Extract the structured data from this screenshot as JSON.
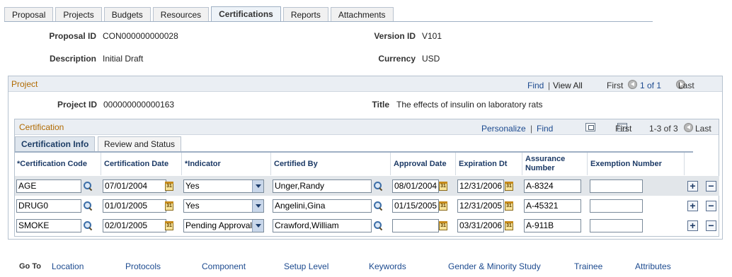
{
  "tabs": [
    {
      "label": "Proposal"
    },
    {
      "label": "Projects"
    },
    {
      "label": "Budgets"
    },
    {
      "label": "Resources"
    },
    {
      "label": "Certifications",
      "active": true
    },
    {
      "label": "Reports"
    },
    {
      "label": "Attachments"
    }
  ],
  "header": {
    "proposal_id_label": "Proposal ID",
    "proposal_id": "CON000000000028",
    "version_id_label": "Version ID",
    "version_id": "V101",
    "description_label": "Description",
    "description": "Initial Draft",
    "currency_label": "Currency",
    "currency": "USD"
  },
  "project": {
    "title": "Project",
    "find": "Find",
    "sep": "|",
    "view_all": "View All",
    "first": "First",
    "range": "1 of 1",
    "last": "Last",
    "project_id_label": "Project ID",
    "project_id": "000000000000163",
    "title_label": "Title",
    "title_value": "The effects of insulin on laboratory rats"
  },
  "certification": {
    "title": "Certification",
    "personalize": "Personalize",
    "sep": "|",
    "find": "Find",
    "first": "First",
    "range": "1-3 of 3",
    "last": "Last",
    "subtabs": [
      "Certification Info",
      "Review and Status"
    ],
    "columns": {
      "code": "*Certification Code",
      "date": "Certification Date",
      "indicator": "*Indicator",
      "certified_by": "Certified By",
      "approval_date": "Approval Date",
      "expiration": "Expiration Dt",
      "assurance": "Assurance Number",
      "exemption": "Exemption Number"
    },
    "rows": [
      {
        "code": "AGE",
        "date": "07/01/2004",
        "indicator": "Yes",
        "certified_by": "Unger,Randy",
        "approval_date": "08/01/2004",
        "expiration": "12/31/2006",
        "assurance": "A-8324",
        "exemption": ""
      },
      {
        "code": "DRUG0",
        "date": "01/01/2005",
        "indicator": "Yes",
        "certified_by": "Angelini,Gina",
        "approval_date": "01/15/2005",
        "expiration": "12/31/2005",
        "assurance": "A-45321",
        "exemption": ""
      },
      {
        "code": "SMOKE",
        "date": "02/01/2005",
        "indicator": "Pending Approval",
        "certified_by": "Crawford,William",
        "approval_date": "",
        "expiration": "03/31/2006",
        "assurance": "A-911B",
        "exemption": ""
      }
    ],
    "add_symbol": "+",
    "remove_symbol": "−"
  },
  "goto": {
    "label": "Go To",
    "links": [
      "Location",
      "Protocols",
      "Component",
      "Setup Level",
      "Keywords",
      "Gender & Minority Study",
      "Trainee",
      "Attributes"
    ]
  }
}
